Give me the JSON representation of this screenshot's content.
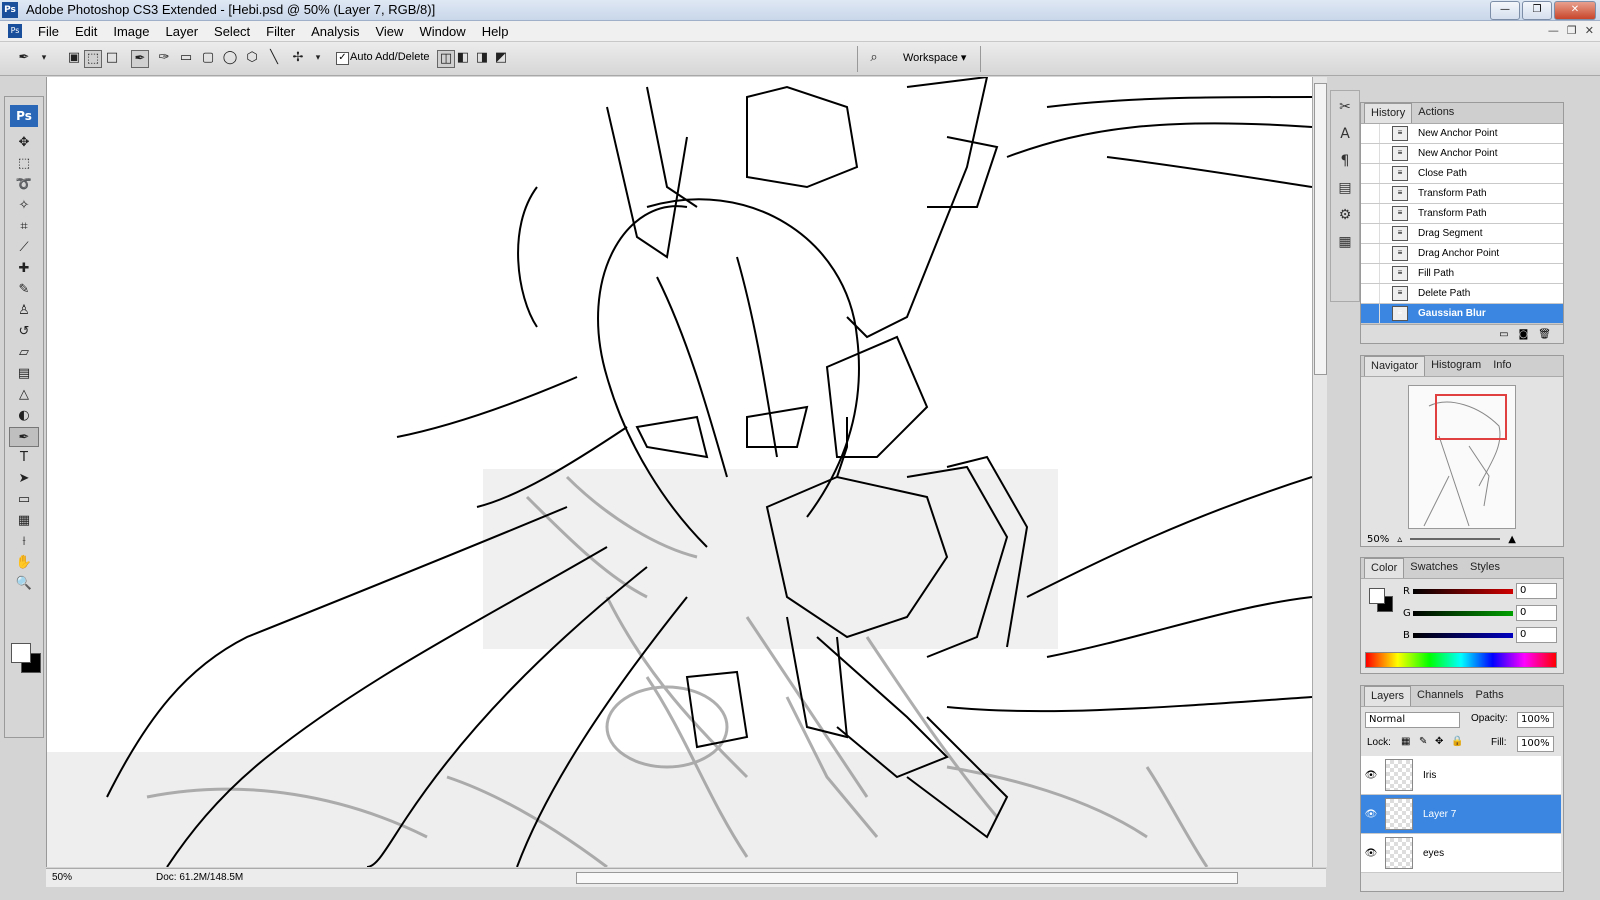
{
  "window": {
    "title": "Adobe Photoshop CS3 Extended - [Hebi.psd @ 50% (Layer 7, RGB/8)]",
    "logo": "Ps"
  },
  "menu": [
    "File",
    "Edit",
    "Image",
    "Layer",
    "Select",
    "Filter",
    "Analysis",
    "View",
    "Window",
    "Help"
  ],
  "options": {
    "auto_add_delete_label": "Auto Add/Delete",
    "auto_add_delete_checked": true,
    "workspace_label": "Workspace ▾"
  },
  "toolbox": {
    "badge": "Ps",
    "tools": [
      {
        "name": "move-tool-icon",
        "glyph": "✥"
      },
      {
        "name": "marquee-tool-icon",
        "glyph": "⬚"
      },
      {
        "name": "lasso-tool-icon",
        "glyph": "➰"
      },
      {
        "name": "magic-wand-tool-icon",
        "glyph": "✧"
      },
      {
        "name": "crop-tool-icon",
        "glyph": "⌗"
      },
      {
        "name": "slice-tool-icon",
        "glyph": "⟋"
      },
      {
        "name": "healing-brush-tool-icon",
        "glyph": "✚"
      },
      {
        "name": "brush-tool-icon",
        "glyph": "✎"
      },
      {
        "name": "clone-stamp-tool-icon",
        "glyph": "♙"
      },
      {
        "name": "history-brush-tool-icon",
        "glyph": "↺"
      },
      {
        "name": "eraser-tool-icon",
        "glyph": "▱"
      },
      {
        "name": "gradient-tool-icon",
        "glyph": "▤"
      },
      {
        "name": "blur-tool-icon",
        "glyph": "△"
      },
      {
        "name": "dodge-tool-icon",
        "glyph": "◐"
      },
      {
        "name": "pen-tool-icon",
        "glyph": "✒",
        "active": true
      },
      {
        "name": "type-tool-icon",
        "glyph": "T"
      },
      {
        "name": "path-selection-tool-icon",
        "glyph": "➤"
      },
      {
        "name": "shape-tool-icon",
        "glyph": "▭"
      },
      {
        "name": "notes-tool-icon",
        "glyph": "▦"
      },
      {
        "name": "eyedropper-tool-icon",
        "glyph": "⟊"
      },
      {
        "name": "hand-tool-icon",
        "glyph": "✋"
      },
      {
        "name": "zoom-tool-icon",
        "glyph": "🔍"
      }
    ]
  },
  "status": {
    "zoom": "50%",
    "doc": "Doc: 61.2M/148.5M"
  },
  "history": {
    "tabs": [
      "History",
      "Actions"
    ],
    "items": [
      "New Anchor Point",
      "New Anchor Point",
      "Close Path",
      "Transform Path",
      "Transform Path",
      "Drag Segment",
      "Drag Anchor Point",
      "Fill Path",
      "Delete Path",
      "Gaussian Blur"
    ],
    "selected_index": 9
  },
  "navigator": {
    "tabs": [
      "Navigator",
      "Histogram",
      "Info"
    ],
    "zoom": "50%"
  },
  "color": {
    "tabs": [
      "Color",
      "Swatches",
      "Styles"
    ],
    "channels": [
      {
        "label": "R",
        "value": "0",
        "color": "#d00000"
      },
      {
        "label": "G",
        "value": "0",
        "color": "#00a000"
      },
      {
        "label": "B",
        "value": "0",
        "color": "#0000c0"
      }
    ]
  },
  "layers": {
    "tabs": [
      "Layers",
      "Channels",
      "Paths"
    ],
    "blend_mode": "Normal",
    "opacity_label": "Opacity:",
    "opacity": "100%",
    "lock_label": "Lock:",
    "fill_label": "Fill:",
    "fill": "100%",
    "items": [
      {
        "name": "Iris",
        "selected": false
      },
      {
        "name": "Layer 7",
        "selected": true
      },
      {
        "name": "eyes",
        "selected": false
      }
    ]
  }
}
